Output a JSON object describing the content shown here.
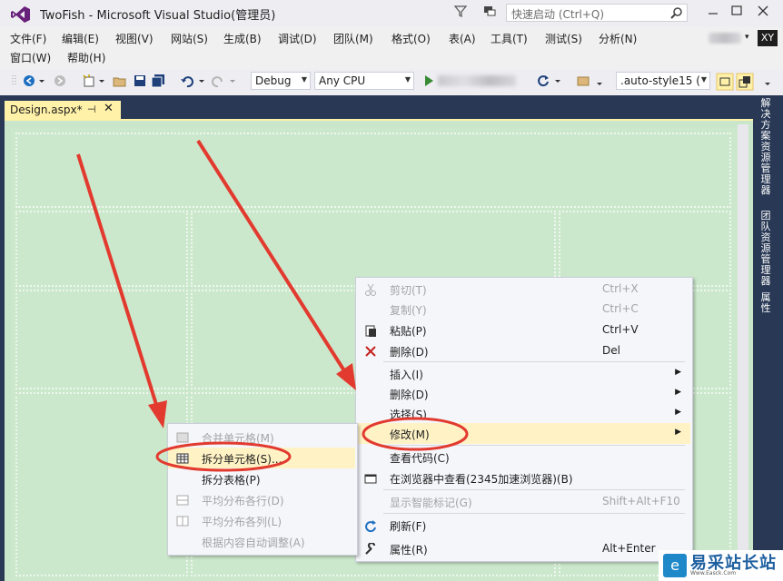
{
  "window": {
    "title": "TwoFish - Microsoft Visual Studio(管理员)",
    "quick_launch_placeholder": "快速启动 (Ctrl+Q)",
    "avatar_initials": "XY",
    "user_caret": "▾"
  },
  "menu_bar": {
    "row1": [
      "文件(F)",
      "编辑(E)",
      "视图(V)",
      "网站(S)",
      "生成(B)",
      "调试(D)",
      "团队(M)",
      "格式(O)",
      "表(A)",
      "工具(T)",
      "测试(S)",
      "分析(N)"
    ],
    "row2": [
      "窗口(W)",
      "帮助(H)"
    ]
  },
  "toolbar": {
    "configuration": "Debug",
    "platform": "Any CPU",
    "style_selector": ".auto-style15 ( "
  },
  "document_tab": {
    "label": "Design.aspx*",
    "pin": "⊣",
    "close": "✕"
  },
  "side_panels": [
    "解决方案资源管理器",
    "团队资源管理器",
    "属性"
  ],
  "context_menu": {
    "items": [
      {
        "label": "剪切(T)",
        "shortcut": "Ctrl+X",
        "disabled": true,
        "icon": "scissors-icon"
      },
      {
        "label": "复制(Y)",
        "shortcut": "Ctrl+C",
        "disabled": true,
        "icon": ""
      },
      {
        "label": "粘贴(P)",
        "shortcut": "Ctrl+V",
        "disabled": false,
        "icon": "paste-icon"
      },
      {
        "label": "删除(D)",
        "shortcut": "Del",
        "disabled": false,
        "icon": "delete-x-icon"
      },
      {
        "label": "插入(I)",
        "shortcut": "",
        "disabled": false,
        "submenu": true
      },
      {
        "label": "删除(D)",
        "shortcut": "",
        "disabled": false,
        "submenu": true
      },
      {
        "label": "选择(S)",
        "shortcut": "",
        "disabled": false,
        "submenu": true
      },
      {
        "label": "修改(M)",
        "shortcut": "",
        "disabled": false,
        "submenu": true,
        "highlighted": true
      },
      {
        "label": "查看代码(C)",
        "shortcut": "",
        "disabled": false
      },
      {
        "label": "在浏览器中查看(2345加速浏览器)(B)",
        "shortcut": "",
        "disabled": false,
        "icon": "browser-icon"
      },
      {
        "label": "显示智能标记(G)",
        "shortcut": "Shift+Alt+F10",
        "disabled": true
      },
      {
        "label": "刷新(F)",
        "shortcut": "",
        "disabled": false,
        "icon": "refresh-icon"
      },
      {
        "label": "属性(R)",
        "shortcut": "Alt+Enter",
        "disabled": false,
        "icon": "wrench-icon"
      }
    ]
  },
  "submenu": {
    "items": [
      {
        "label": "合并单元格(M)",
        "disabled": true,
        "icon": "merge-cells-icon"
      },
      {
        "label": "拆分单元格(S)...",
        "disabled": false,
        "icon": "split-cells-icon",
        "highlighted": true
      },
      {
        "label": "拆分表格(P)",
        "disabled": false
      },
      {
        "label": "平均分布各行(D)",
        "disabled": true,
        "icon": "distribute-rows-icon"
      },
      {
        "label": "平均分布各列(L)",
        "disabled": true,
        "icon": "distribute-columns-icon"
      },
      {
        "label": "根据内容自动调整(A)",
        "disabled": true
      }
    ]
  },
  "watermark": {
    "text": "易采站长站",
    "sub": "Www.Easck.Com"
  },
  "colors": {
    "accent_band": "#293955",
    "tab_active": "#fff1a8",
    "design_bg": "#cce8cc",
    "annotation_red": "#e23a2f",
    "highlight": "#fff3c6"
  }
}
